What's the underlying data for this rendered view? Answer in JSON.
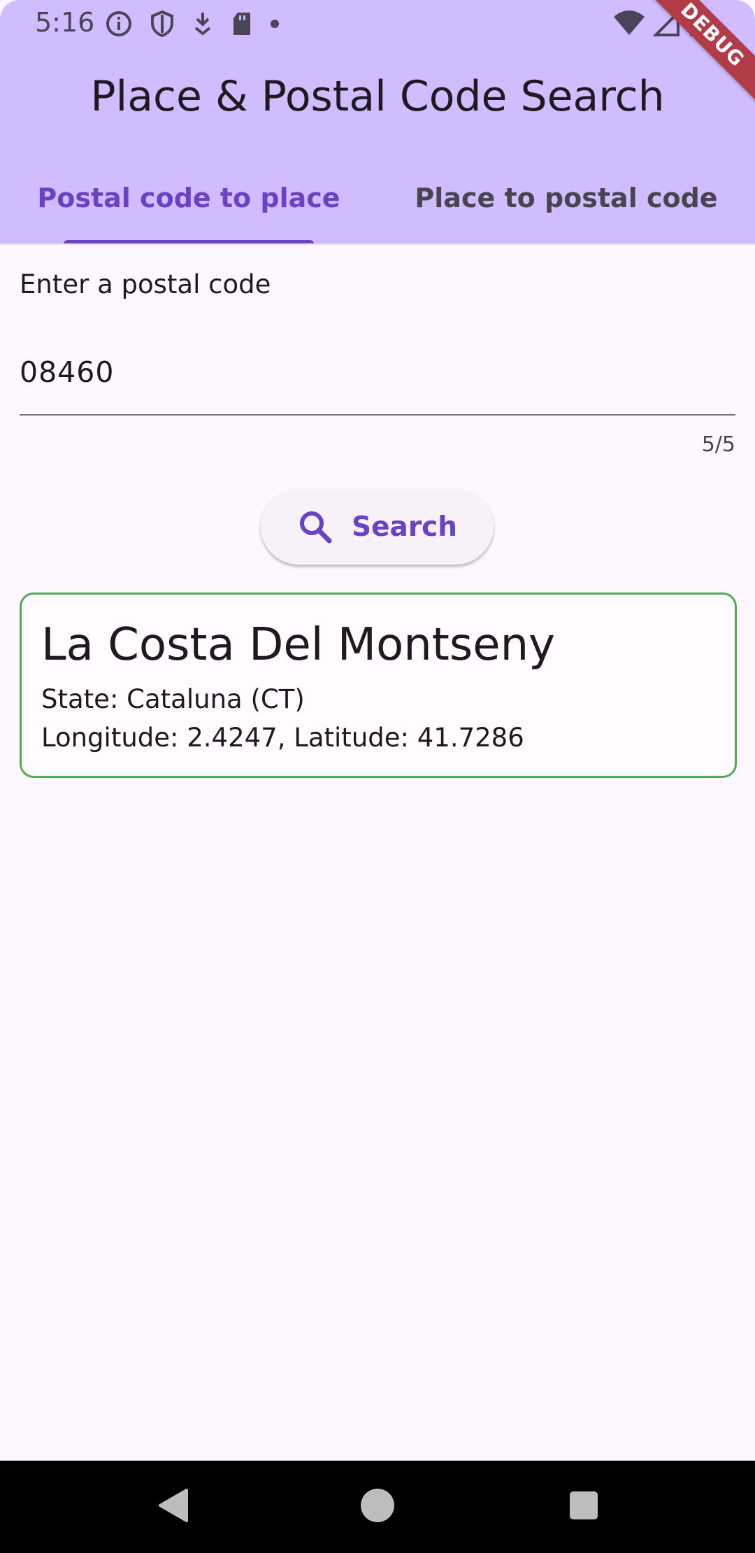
{
  "status_bar": {
    "time": "5:16",
    "icons": [
      "info-icon",
      "shield-icon",
      "download-icon",
      "sd-card-icon",
      "dot-icon"
    ],
    "right_icons": [
      "wifi-icon",
      "cellular-icon",
      "battery-icon"
    ]
  },
  "debug_banner": "DEBUG",
  "app_bar": {
    "title": "Place & Postal Code Search",
    "background": "#D0BCFF"
  },
  "tabs": [
    {
      "label": "Postal code to place",
      "selected": true
    },
    {
      "label": "Place to postal code",
      "selected": false
    }
  ],
  "form": {
    "label": "Enter a postal code",
    "value": "08460",
    "counter": "5/5",
    "search_label": "Search",
    "search_icon": "search-icon"
  },
  "result": {
    "place_name": "La Costa Del Montseny",
    "state": "State: Cataluna (CT)",
    "coordinates": "Longitude: 2.4247, Latitude: 41.7286",
    "border_color": "#4CAF50"
  },
  "colors": {
    "accent": "#6943C4",
    "background": "#FEF7FF"
  },
  "navigation": [
    "back-icon",
    "home-icon",
    "recents-icon"
  ]
}
